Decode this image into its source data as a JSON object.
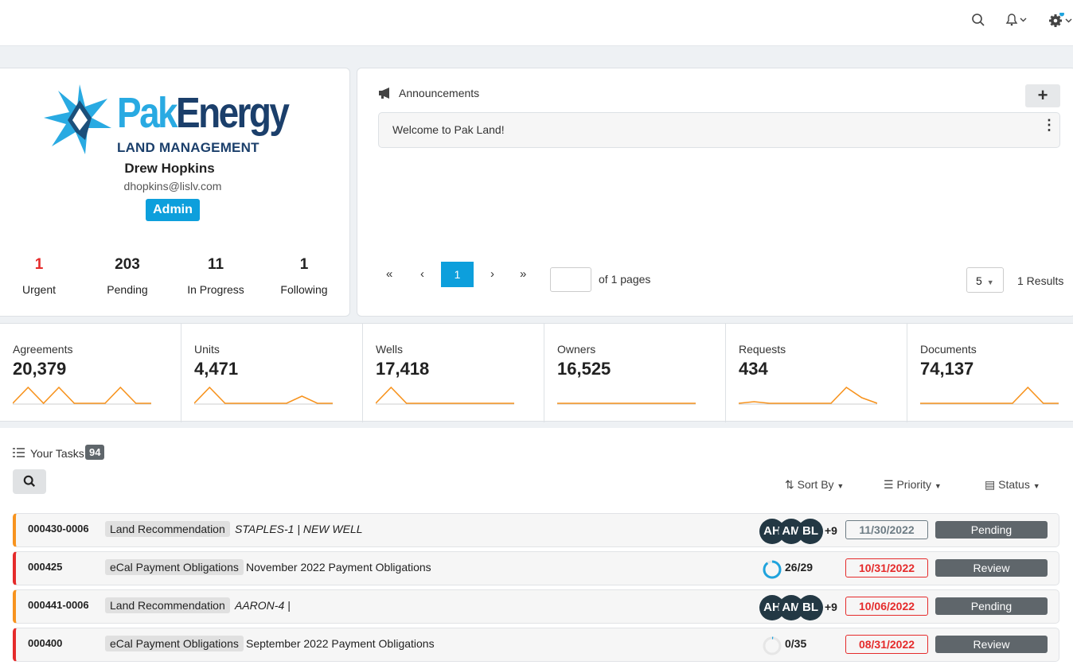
{
  "profile": {
    "brand_top": "PakEnergy",
    "brand_pak": "Pak",
    "brand_energy": "Energy",
    "brand_sub": "LAND MANAGEMENT",
    "name": "Drew Hopkins",
    "email": "dhopkins@lislv.com",
    "role": "Admin",
    "stats": [
      {
        "value": "1",
        "label": "Urgent"
      },
      {
        "value": "203",
        "label": "Pending"
      },
      {
        "value": "11",
        "label": "In Progress"
      },
      {
        "value": "1",
        "label": "Following"
      }
    ]
  },
  "announcements": {
    "title": "Announcements",
    "add": "+",
    "items": [
      {
        "text": "Welcome to Pak Land!"
      }
    ],
    "pager": {
      "first": "«",
      "prev": "‹",
      "current": "1",
      "next": "›",
      "last": "»",
      "of_pages": "of 1 pages",
      "page_size": "5",
      "results": "1 Results"
    }
  },
  "metrics": [
    {
      "label": "Agreements",
      "value": "20,379",
      "trend": [
        0,
        1,
        0,
        1,
        0,
        0,
        0,
        1,
        0,
        0
      ]
    },
    {
      "label": "Units",
      "value": "4,471",
      "trend": [
        0,
        1,
        0,
        0,
        0,
        0,
        0,
        0.45,
        0,
        0
      ]
    },
    {
      "label": "Wells",
      "value": "17,418",
      "trend": [
        0,
        1,
        0,
        0,
        0,
        0,
        0,
        0,
        0,
        0
      ]
    },
    {
      "label": "Owners",
      "value": "16,525",
      "trend": [
        0,
        0,
        0,
        0,
        0,
        0,
        0,
        0,
        0,
        0
      ]
    },
    {
      "label": "Requests",
      "value": "434",
      "trend": [
        0,
        0.1,
        0,
        0,
        0,
        0,
        0,
        1,
        0.35,
        0
      ]
    },
    {
      "label": "Documents",
      "value": "74,137",
      "trend": [
        0,
        0,
        0,
        0,
        0,
        0,
        0,
        1,
        0,
        0
      ]
    }
  ],
  "tasks": {
    "title": "Your Tasks",
    "count": "94",
    "sort": "Sort By",
    "priority": "Priority",
    "status": "Status",
    "rows": [
      {
        "id": "000430-0006",
        "category": "Land Recommendation",
        "desc": "STAPLES-1 | NEW WELL",
        "italic": true,
        "avatars": [
          "AH",
          "AM",
          "BL"
        ],
        "more": "+9",
        "date": "11/30/2022",
        "overdue": false,
        "status": "Pending",
        "priority": "orange"
      },
      {
        "id": "000425",
        "category": "eCal Payment Obligations",
        "desc": "November 2022 Payment Obligations",
        "italic": false,
        "progress": "26/29",
        "progress_value": 0.897,
        "date": "10/31/2022",
        "overdue": true,
        "status": "Review",
        "priority": "red"
      },
      {
        "id": "000441-0006",
        "category": "Land Recommendation",
        "desc": "AARON-4 |",
        "italic": true,
        "avatars": [
          "AH",
          "AM",
          "BL"
        ],
        "more": "+9",
        "date": "10/06/2022",
        "overdue": true,
        "status": "Pending",
        "priority": "orange"
      },
      {
        "id": "000400",
        "category": "eCal Payment Obligations",
        "desc": "September 2022 Payment Obligations",
        "italic": false,
        "progress": "0/35",
        "progress_value": 0.0,
        "date": "08/31/2022",
        "overdue": true,
        "status": "Review",
        "priority": "red"
      }
    ]
  }
}
